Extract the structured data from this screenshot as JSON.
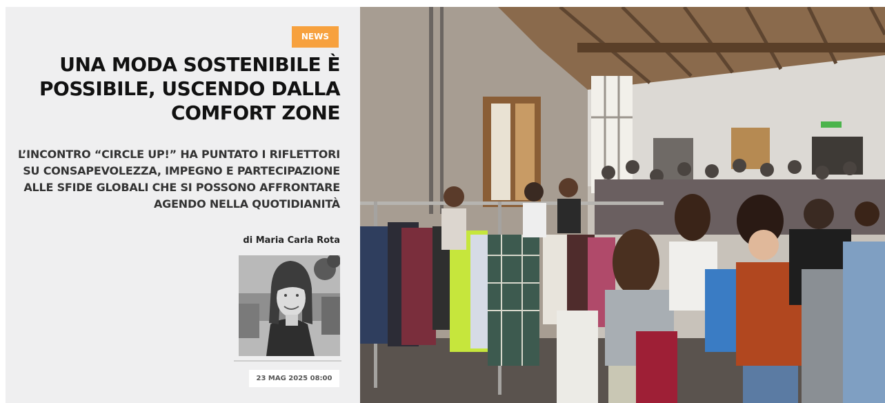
{
  "article": {
    "badge": "NEWS",
    "title": "UNA MODA SOSTENIBILE È POSSIBILE, USCENDO DALLA COMFORT ZONE",
    "subtitle": "L’INCONTRO “CIRCLE UP!” HA PUNTATO I RIFLETTORI SU CONSAPEVOLEZZA, IMPEGNO E PARTECIPAZIONE ALLE SFIDE GLOBALI CHE SI POSSONO AFFRONTARE AGENDO NELLA QUOTIDIANITÀ",
    "byline": "di Maria Carla Rota",
    "date": "23 MAG 2025 08:00"
  },
  "colors": {
    "panel_background": "#efeff0",
    "badge_background": "#f7a13e",
    "badge_text": "#ffffff",
    "title_text": "#111111",
    "subtitle_text": "#333333"
  },
  "images": {
    "author_photo": "black-and-white portrait",
    "hero_photo": "clothing swap event with garment racks and crowd"
  }
}
